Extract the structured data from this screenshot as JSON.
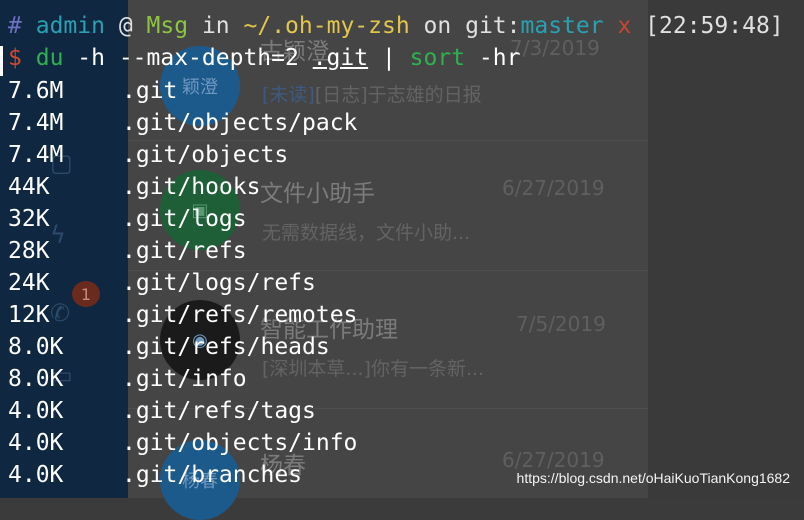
{
  "background_app": {
    "avatar_texts": [
      "颖澄",
      "",
      "",
      "杨春"
    ],
    "badge": "1",
    "chats": [
      {
        "name": "古颖澄",
        "date": "7/3/2019",
        "unread": "[未读]",
        "preview": "[日志]于志雄的日报"
      },
      {
        "name": "文件小助手",
        "date": "6/27/2019",
        "unread": "",
        "preview": "无需数据线，文件小助..."
      },
      {
        "name": "智能工作助理",
        "date": "7/5/2019",
        "unread": "",
        "preview": "[深圳本草...]你有一条新..."
      },
      {
        "name": "杨春",
        "date": "6/27/2019",
        "unread": "",
        "preview": ""
      }
    ]
  },
  "prompt": {
    "hash": "#",
    "user": "admin",
    "at": "@",
    "host": "Msg",
    "in": "in",
    "path": "~/.oh-my-zsh",
    "on": "on",
    "git_label": "git:",
    "branch": "master",
    "dirty": "x",
    "time": "[22:59:48]"
  },
  "command": {
    "dollar": "$",
    "cmd": "du",
    "args": "-h --max-depth=2",
    "target": ".git",
    "pipe": "|",
    "sort_cmd": "sort",
    "sort_args": "-hr"
  },
  "output": [
    {
      "size": "7.6M",
      "path": ".git"
    },
    {
      "size": "7.4M",
      "path": ".git/objects/pack"
    },
    {
      "size": "7.4M",
      "path": ".git/objects"
    },
    {
      "size": "44K",
      "path": ".git/hooks"
    },
    {
      "size": "32K",
      "path": ".git/logs"
    },
    {
      "size": "28K",
      "path": ".git/refs"
    },
    {
      "size": "24K",
      "path": ".git/logs/refs"
    },
    {
      "size": "12K",
      "path": ".git/refs/remotes"
    },
    {
      "size": "8.0K",
      "path": ".git/refs/heads"
    },
    {
      "size": "8.0K",
      "path": ".git/info"
    },
    {
      "size": "4.0K",
      "path": ".git/refs/tags"
    },
    {
      "size": "4.0K",
      "path": ".git/objects/info"
    },
    {
      "size": "4.0K",
      "path": ".git/branches"
    }
  ],
  "watermark": "https://blog.csdn.net/oHaiKuoTianKong1682",
  "icons": [
    "chat-bubble-icon",
    "lightning-icon",
    "phone-icon",
    "calendar-icon",
    "penguin-icon"
  ]
}
